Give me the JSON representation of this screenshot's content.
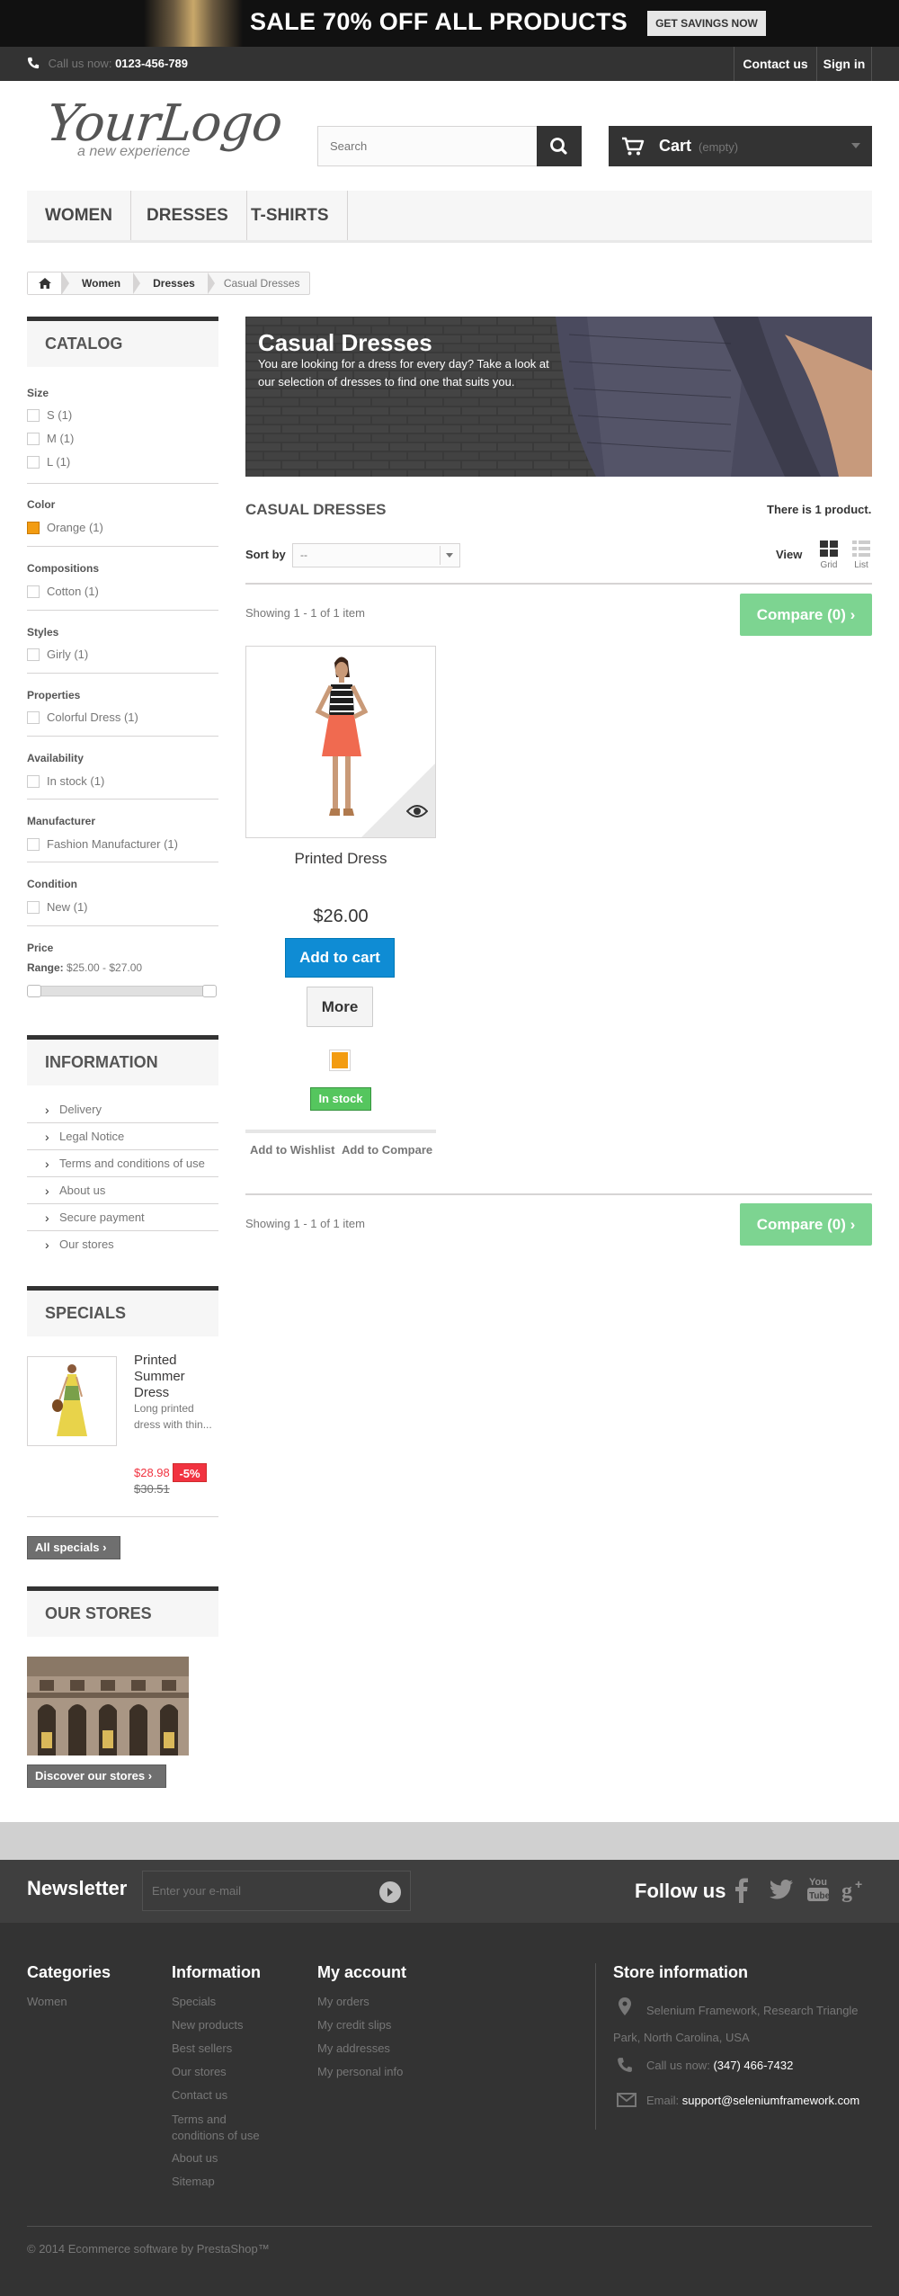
{
  "banner": {
    "text": "SALE 70% OFF ALL PRODUCTS",
    "button": "GET SAVINGS NOW"
  },
  "topnav": {
    "call_label": "Call us now:",
    "phone": "0123-456-789",
    "contact": "Contact us",
    "signin": "Sign in"
  },
  "header": {
    "logo_main": "YourLogo",
    "logo_sub": "a new experience",
    "search_placeholder": "Search",
    "cart_label": "Cart",
    "cart_status": "(empty)"
  },
  "menu": [
    "WOMEN",
    "DRESSES",
    "T-SHIRTS"
  ],
  "breadcrumb": {
    "items": [
      "Women",
      "Dresses"
    ],
    "current": "Casual Dresses"
  },
  "catalog": {
    "title": "CATALOG",
    "filters": [
      {
        "title": "Size",
        "options": [
          "S (1)",
          "M (1)",
          "L (1)"
        ]
      },
      {
        "title": "Color",
        "options": [
          "Orange (1)"
        ]
      },
      {
        "title": "Compositions",
        "options": [
          "Cotton (1)"
        ]
      },
      {
        "title": "Styles",
        "options": [
          "Girly (1)"
        ]
      },
      {
        "title": "Properties",
        "options": [
          "Colorful Dress (1)"
        ]
      },
      {
        "title": "Availability",
        "options": [
          "In stock (1)"
        ]
      },
      {
        "title": "Manufacturer",
        "options": [
          "Fashion Manufacturer (1)"
        ]
      },
      {
        "title": "Condition",
        "options": [
          "New (1)"
        ]
      }
    ],
    "price_title": "Price",
    "price_range_label": "Range:",
    "price_range": "$25.00 - $27.00",
    "color_swatch": "#f39c11"
  },
  "information": {
    "title": "INFORMATION",
    "items": [
      "Delivery",
      "Legal Notice",
      "Terms and conditions of use",
      "About us",
      "Secure payment",
      "Our stores"
    ]
  },
  "specials": {
    "title": "SPECIALS",
    "product_name": "Printed Summer Dress",
    "product_desc": "Long printed dress with thin...",
    "price": "$28.98",
    "discount": "-5%",
    "old_price": "$30.51",
    "all_specials": "All specials"
  },
  "stores": {
    "title": "OUR STORES",
    "discover": "Discover our stores"
  },
  "category": {
    "banner_title": "Casual Dresses",
    "banner_desc": "You are looking for a dress for every day? Take a look at our selection of dresses to find one that suits you.",
    "heading": "CASUAL DRESSES",
    "count": "There is 1 product.",
    "sort_label": "Sort by",
    "sort_value": "--",
    "view_label": "View",
    "view_grid": "Grid",
    "view_list": "List",
    "showing": "Showing 1 - 1 of 1 item",
    "compare": "Compare (0)"
  },
  "product": {
    "name": "Printed Dress",
    "price": "$26.00",
    "add_to_cart": "Add to cart",
    "more": "More",
    "stock": "In stock",
    "wishlist": "Add to Wishlist",
    "add_compare": "Add to Compare",
    "color_swatch": "#f39c11"
  },
  "newsletter": {
    "title": "Newsletter",
    "placeholder": "Enter your e-mail",
    "follow": "Follow us"
  },
  "footer": {
    "categories_title": "Categories",
    "categories": [
      "Women"
    ],
    "information_title": "Information",
    "information": [
      "Specials",
      "New products",
      "Best sellers",
      "Our stores",
      "Contact us",
      "Terms and conditions of use",
      "About us",
      "Sitemap"
    ],
    "account_title": "My account",
    "account": [
      "My orders",
      "My credit slips",
      "My addresses",
      "My personal info"
    ],
    "store_title": "Store information",
    "address": "Selenium Framework, Research Triangle Park, North Carolina, USA",
    "call_label": "Call us now:",
    "phone": "(347) 466-7432",
    "email_label": "Email:",
    "email": "support@seleniumframework.com",
    "copyright": "© 2014 Ecommerce software by PrestaShop™"
  }
}
